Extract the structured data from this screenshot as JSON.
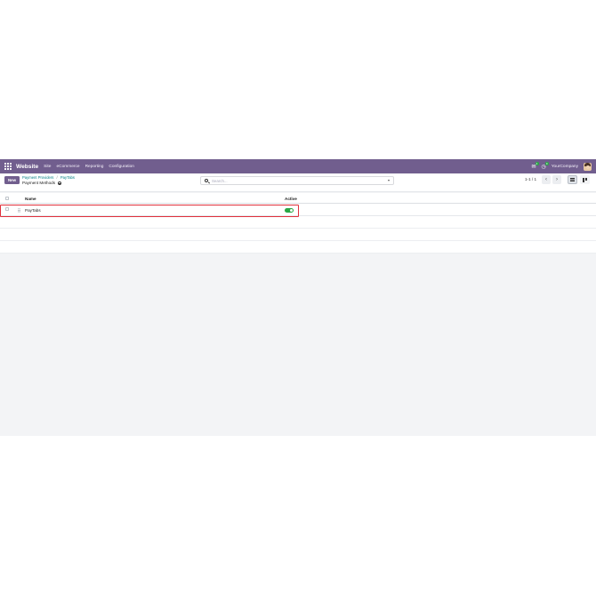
{
  "navbar": {
    "app_name": "Website",
    "menu": [
      "Site",
      "eCommerce",
      "Reporting",
      "Configuration"
    ],
    "messages_count": "4",
    "activity_count": "9",
    "company": "YourCompany"
  },
  "control": {
    "new_label": "New",
    "breadcrumb": [
      "Payment Providers",
      "PayTabs"
    ],
    "breadcrumb_sep": "/",
    "current_title": "Payment Methods",
    "search_placeholder": "Search...",
    "pager": "1-1 / 1",
    "prev_symbol": "‹",
    "next_symbol": "›"
  },
  "table": {
    "columns": [
      "Name",
      "Active"
    ],
    "rows": [
      {
        "name": "PayTabs",
        "active": true
      }
    ]
  },
  "colors": {
    "navbar": "#715e8e",
    "toggle_on": "#28a745",
    "highlight": "#e0313d"
  }
}
